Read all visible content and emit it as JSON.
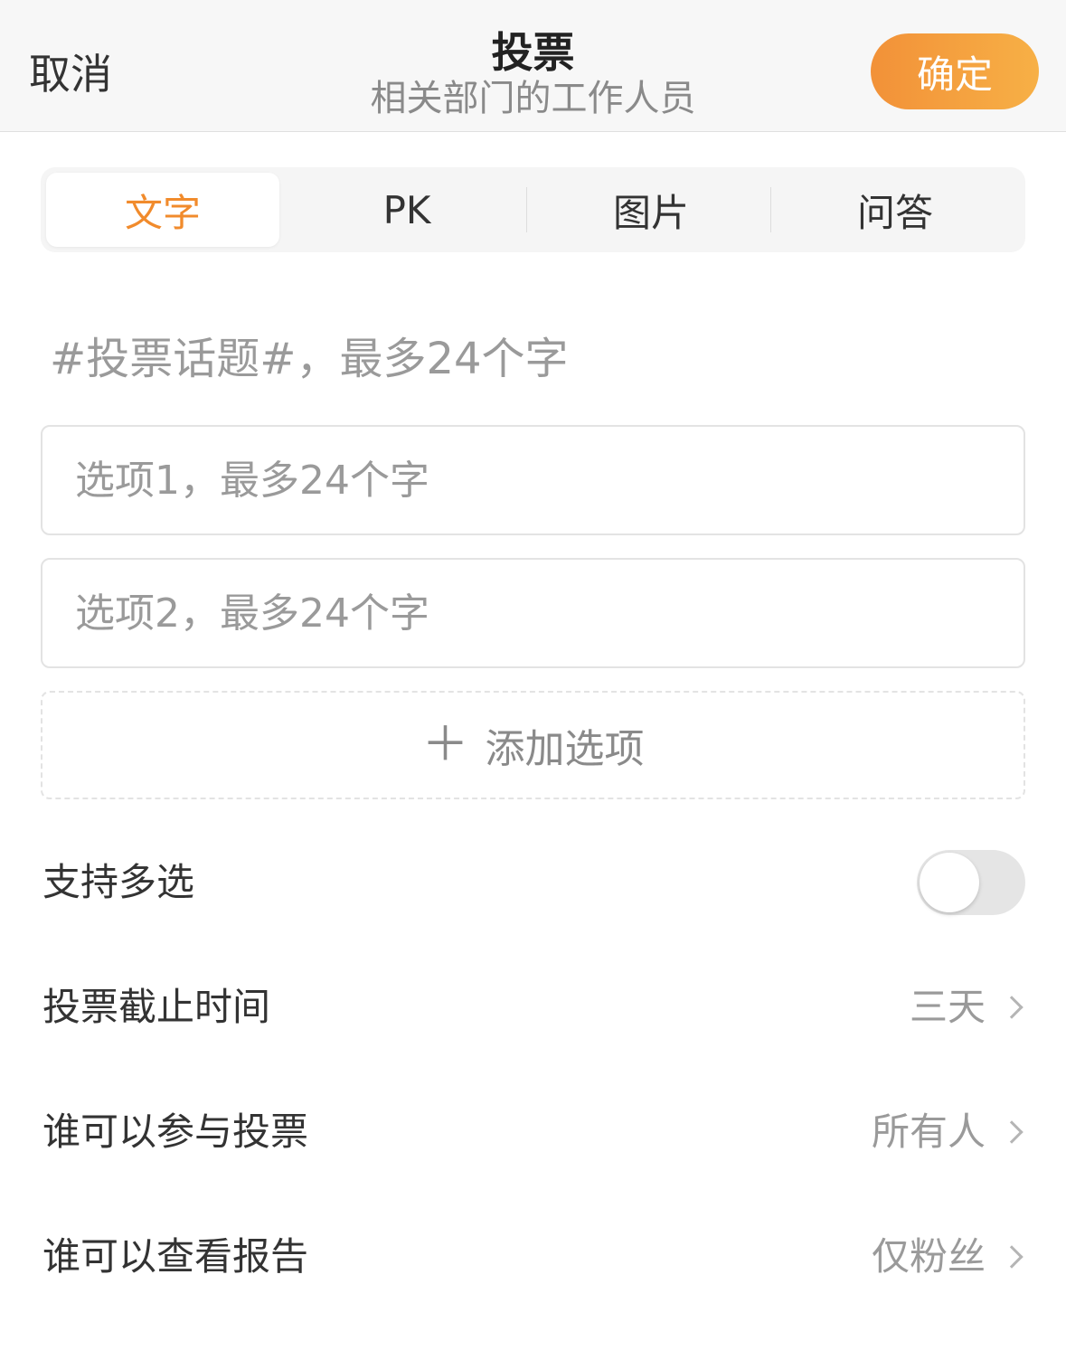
{
  "header": {
    "cancel_label": "取消",
    "title": "投票",
    "subtitle": "相关部门的工作人员",
    "confirm_label": "确定",
    "accent_gradient": [
      "#f29138",
      "#f7b046"
    ]
  },
  "tabs": [
    {
      "label": "文字",
      "active": true
    },
    {
      "label": "PK",
      "active": false
    },
    {
      "label": "图片",
      "active": false
    },
    {
      "label": "问答",
      "active": false
    }
  ],
  "accent_color": "#f18b2c",
  "form": {
    "topic_placeholder": "#投票话题#，最多24个字",
    "topic_value": "",
    "options": [
      {
        "placeholder": "选项1，最多24个字",
        "value": ""
      },
      {
        "placeholder": "选项2，最多24个字",
        "value": ""
      }
    ],
    "add_option_icon": "plus-icon",
    "add_option_label": "添加选项"
  },
  "settings": {
    "multi_select": {
      "label": "支持多选",
      "enabled": false
    },
    "deadline": {
      "label": "投票截止时间",
      "value": "三天"
    },
    "who_can_vote": {
      "label": "谁可以参与投票",
      "value": "所有人"
    },
    "who_can_view_report": {
      "label": "谁可以查看报告",
      "value": "仅粉丝"
    }
  }
}
